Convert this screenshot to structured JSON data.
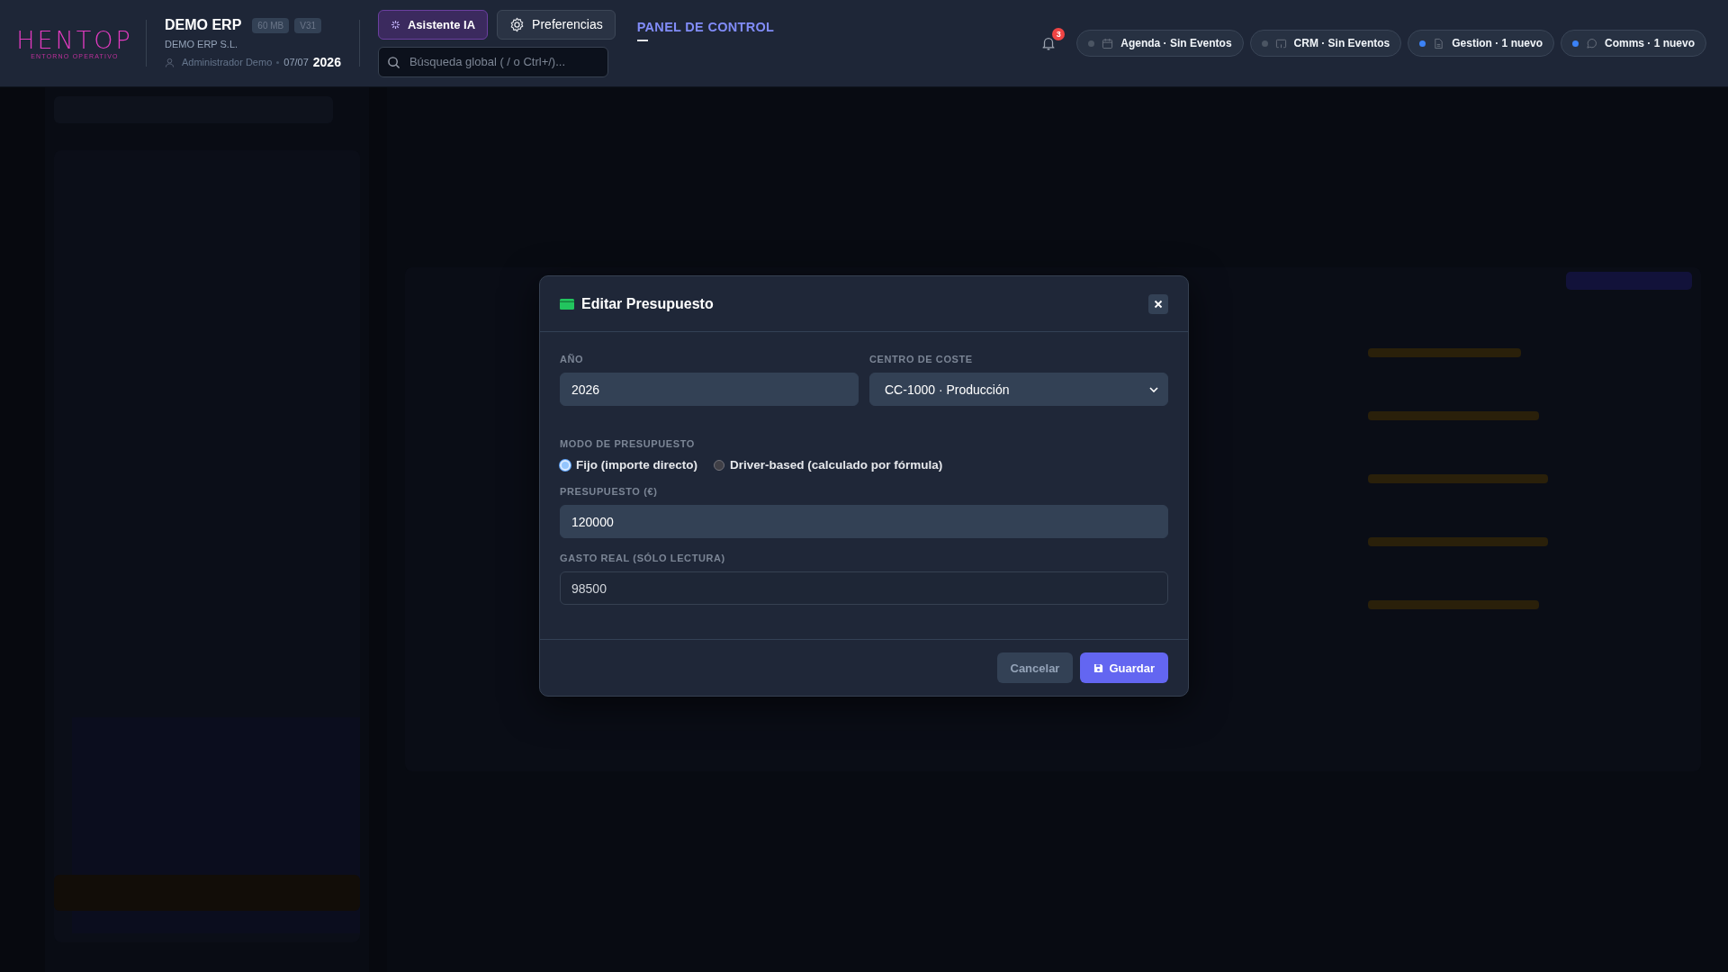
{
  "header": {
    "logo": {
      "name": "HENTOP",
      "tagline": "ENTORNO OPERATIVO"
    },
    "company": {
      "name": "DEMO ERP",
      "badges": [
        "60 MB",
        "V31"
      ],
      "legal_name": "DEMO ERP S.L.",
      "user": "Administrador Demo",
      "date": "07/07",
      "year": "2026"
    },
    "assistant_button": "Asistente IA",
    "preferences_button": "Preferencias",
    "search": {
      "placeholder": "Búsqueda global ( / o Ctrl+/)..."
    },
    "section_title": "PANEL DE CONTROL",
    "notifications": {
      "count": "3"
    },
    "chips": [
      {
        "kind": "calendar",
        "label": "Agenda · Sin Eventos",
        "color": "#4b5563"
      },
      {
        "kind": "monitor",
        "label": "CRM · Sin Eventos",
        "color": "#4b5563"
      },
      {
        "kind": "document",
        "label": "Gestion · 1 nuevo",
        "color": "#3b82f6"
      },
      {
        "kind": "chat",
        "label": "Comms · 1 nuevo",
        "color": "#3b82f6"
      }
    ]
  },
  "modal": {
    "title": "Editar Presupuesto",
    "year": {
      "label": "AÑO",
      "value": "2026"
    },
    "cost_center": {
      "label": "CENTRO DE COSTE",
      "value": "CC-1000 · Producción"
    },
    "mode": {
      "label": "MODO DE PRESUPUESTO",
      "options": [
        {
          "label": "Fijo (importe directo)",
          "selected": true
        },
        {
          "label": "Driver-based (calculado por fórmula)",
          "selected": false
        }
      ]
    },
    "budget": {
      "label": "PRESUPUESTO (€)",
      "value": "120000"
    },
    "actual": {
      "label": "GASTO REAL (SÓLO LECTURA)",
      "value": "98500"
    },
    "cancel_button": "Cancelar",
    "save_button": "Guardar"
  }
}
